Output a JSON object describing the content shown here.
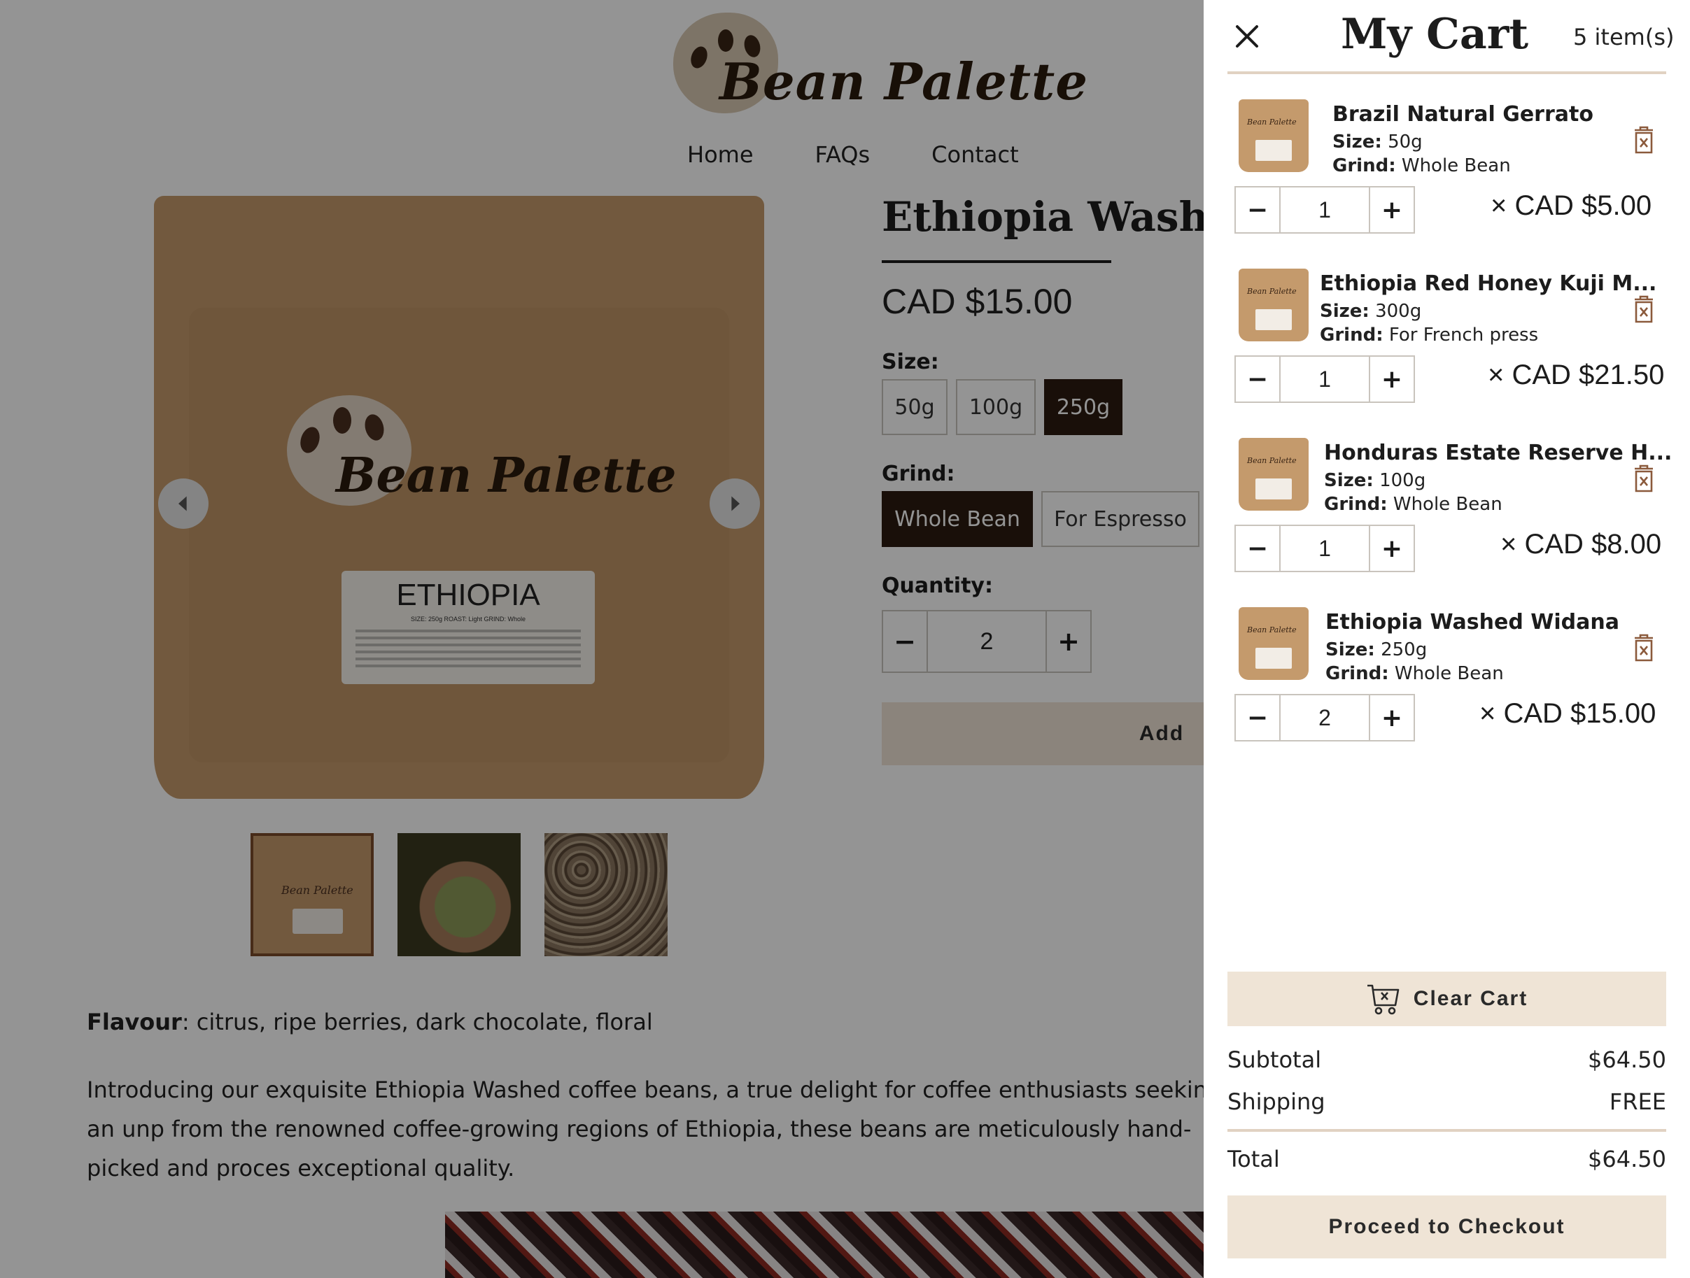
{
  "brand": {
    "name": "Bean Palette"
  },
  "nav": {
    "items": [
      "Home",
      "FAQs",
      "Contact"
    ]
  },
  "product": {
    "title": "Ethiopia Washed",
    "price": "CAD $15.00",
    "bag_label": {
      "origin": "ETHIOPIA",
      "meta": "SIZE: 250g     ROAST: Light     GRIND: Whole"
    },
    "size_label": "Size:",
    "sizes": [
      "50g",
      "100g",
      "250g"
    ],
    "selected_size": "250g",
    "grind_label": "Grind:",
    "grinds": [
      "Whole Bean",
      "For Espresso"
    ],
    "selected_grind": "Whole Bean",
    "quantity_label": "Quantity:",
    "quantity": "2",
    "add_button": "Add",
    "flavour_label": "Flavour",
    "flavour_text": ": citrus, ripe berries, dark chocolate, floral",
    "intro": "Introducing our exquisite Ethiopia Washed coffee beans, a true delight for coffee enthusiasts seeking an unp from the renowned coffee-growing regions of Ethiopia, these beans are meticulously hand-picked and proces exceptional quality."
  },
  "cart": {
    "title": "My Cart",
    "count": "5 item(s)",
    "items": [
      {
        "name": "Brazil Natural Gerrato",
        "size_label": "Size:",
        "size": " 50g",
        "grind_label": "Grind:",
        "grind": " Whole Bean",
        "qty": "1",
        "price": "× CAD $5.00"
      },
      {
        "name": "Ethiopia Red Honey Kuji M...",
        "size_label": "Size:",
        "size": " 300g",
        "grind_label": "Grind:",
        "grind": " For French press",
        "qty": "1",
        "price": "× CAD $21.50"
      },
      {
        "name": "Honduras Estate Reserve H...",
        "size_label": "Size:",
        "size": " 100g",
        "grind_label": "Grind:",
        "grind": " Whole Bean",
        "qty": "1",
        "price": "× CAD $8.00"
      },
      {
        "name": "Ethiopia Washed Widana",
        "size_label": "Size:",
        "size": " 250g",
        "grind_label": "Grind:",
        "grind": " Whole Bean",
        "qty": "2",
        "price": "× CAD $15.00"
      }
    ],
    "clear_label": "Clear Cart",
    "subtotal_label": "Subtotal",
    "subtotal": "$64.50",
    "shipping_label": "Shipping",
    "shipping": "FREE",
    "total_label": "Total",
    "total": "$64.50",
    "checkout_label": "Proceed to Checkout"
  },
  "colors": {
    "accent_dark": "#2b1b10",
    "button_beige": "#efe4d6",
    "bag_kraft": "#c49a6c",
    "trash_icon": "#8b5a3c"
  }
}
